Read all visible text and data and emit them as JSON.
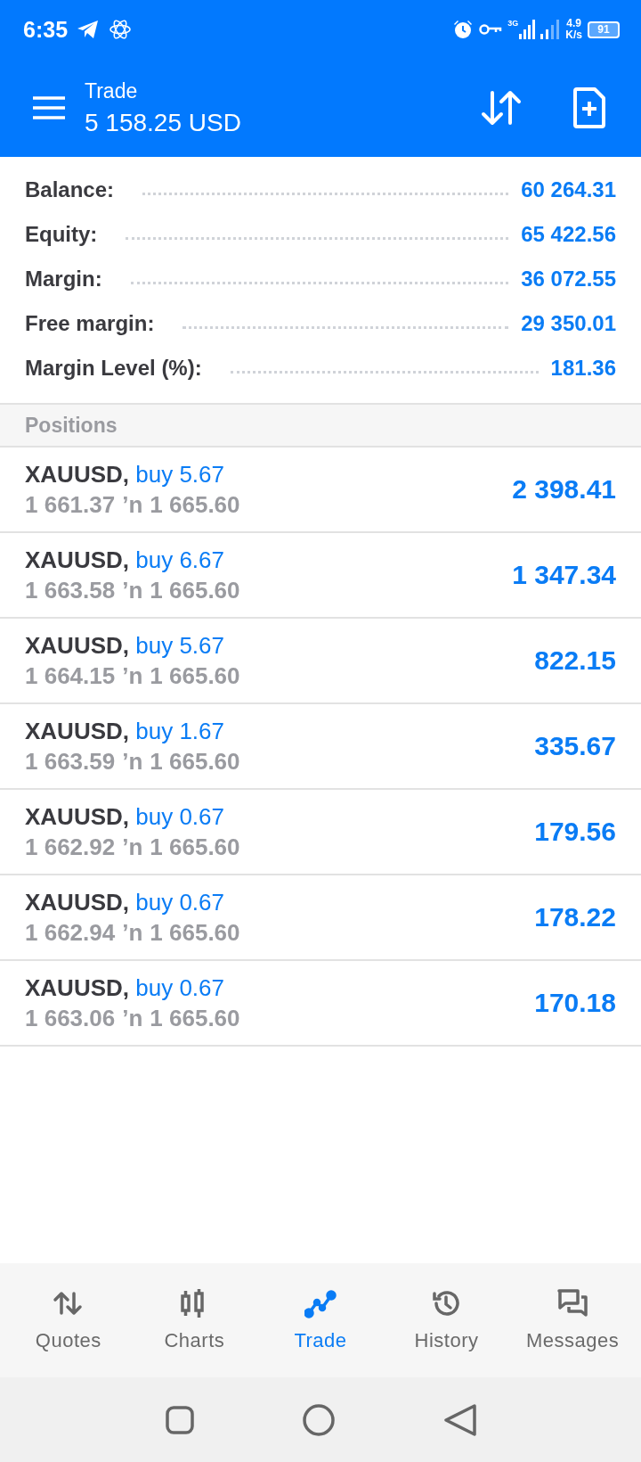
{
  "status_bar": {
    "time": "6:35",
    "network_label": "3G",
    "speed": "4.9",
    "speed_unit": "K/s",
    "battery": "91"
  },
  "app_bar": {
    "title": "Trade",
    "subtitle": "5 158.25 USD"
  },
  "account": [
    {
      "label": "Balance:",
      "value": "60 264.31"
    },
    {
      "label": "Equity:",
      "value": "65 422.56"
    },
    {
      "label": "Margin:",
      "value": "36 072.55"
    },
    {
      "label": "Free margin:",
      "value": "29 350.01"
    },
    {
      "label": "Margin Level (%):",
      "value": "181.36"
    }
  ],
  "positions_header": "Positions",
  "positions": [
    {
      "symbol": "XAUUSD,",
      "side": "buy 5.67",
      "open_price": "1 661.37",
      "arrow": "’n",
      "current_price": "1 665.60",
      "profit": "2 398.41"
    },
    {
      "symbol": "XAUUSD,",
      "side": "buy 6.67",
      "open_price": "1 663.58",
      "arrow": "’n",
      "current_price": "1 665.60",
      "profit": "1 347.34"
    },
    {
      "symbol": "XAUUSD,",
      "side": "buy 5.67",
      "open_price": "1 664.15",
      "arrow": "’n",
      "current_price": "1 665.60",
      "profit": "822.15"
    },
    {
      "symbol": "XAUUSD,",
      "side": "buy 1.67",
      "open_price": "1 663.59",
      "arrow": "’n",
      "current_price": "1 665.60",
      "profit": "335.67"
    },
    {
      "symbol": "XAUUSD,",
      "side": "buy 0.67",
      "open_price": "1 662.92",
      "arrow": "’n",
      "current_price": "1 665.60",
      "profit": "179.56"
    },
    {
      "symbol": "XAUUSD,",
      "side": "buy 0.67",
      "open_price": "1 662.94",
      "arrow": "’n",
      "current_price": "1 665.60",
      "profit": "178.22"
    },
    {
      "symbol": "XAUUSD,",
      "side": "buy 0.67",
      "open_price": "1 663.06",
      "arrow": "’n",
      "current_price": "1 665.60",
      "profit": "170.18"
    }
  ],
  "bottom_nav": [
    {
      "kind": "quotes",
      "label": "Quotes",
      "selected": false
    },
    {
      "kind": "charts",
      "label": "Charts",
      "selected": false
    },
    {
      "kind": "trade",
      "label": "Trade",
      "selected": true
    },
    {
      "kind": "history",
      "label": "History",
      "selected": false
    },
    {
      "kind": "messages",
      "label": "Messages",
      "selected": false
    }
  ]
}
